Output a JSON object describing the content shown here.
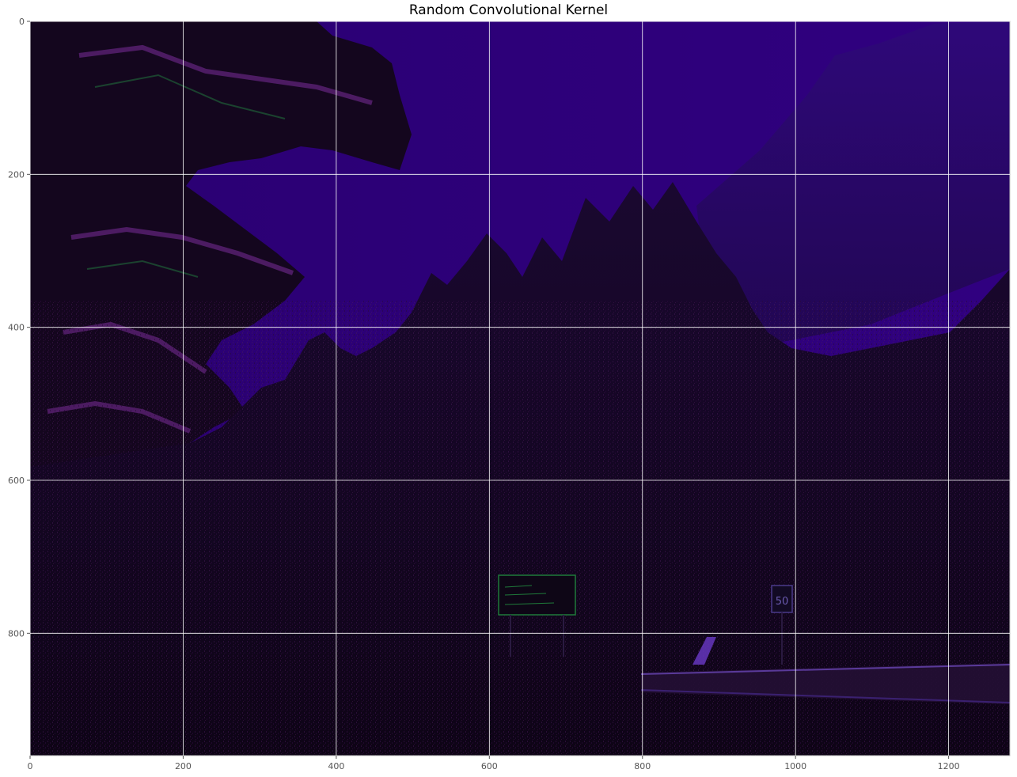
{
  "title": "Random Convolutional Kernel",
  "image_width": 1280,
  "image_height": 960,
  "x_ticks": [
    0,
    200,
    400,
    600,
    800,
    1000,
    1200
  ],
  "y_ticks": [
    0,
    200,
    400,
    600,
    800
  ],
  "grid": true,
  "image_description_colors": {
    "sky": "#2a0072",
    "forest": "#12061e",
    "edge_highlight": "#8a3aa8",
    "green_edge": "#1f7a3a",
    "grid": "#ffffff",
    "frame": "#bfbfbf"
  },
  "signs": {
    "speed_limit": "50"
  }
}
